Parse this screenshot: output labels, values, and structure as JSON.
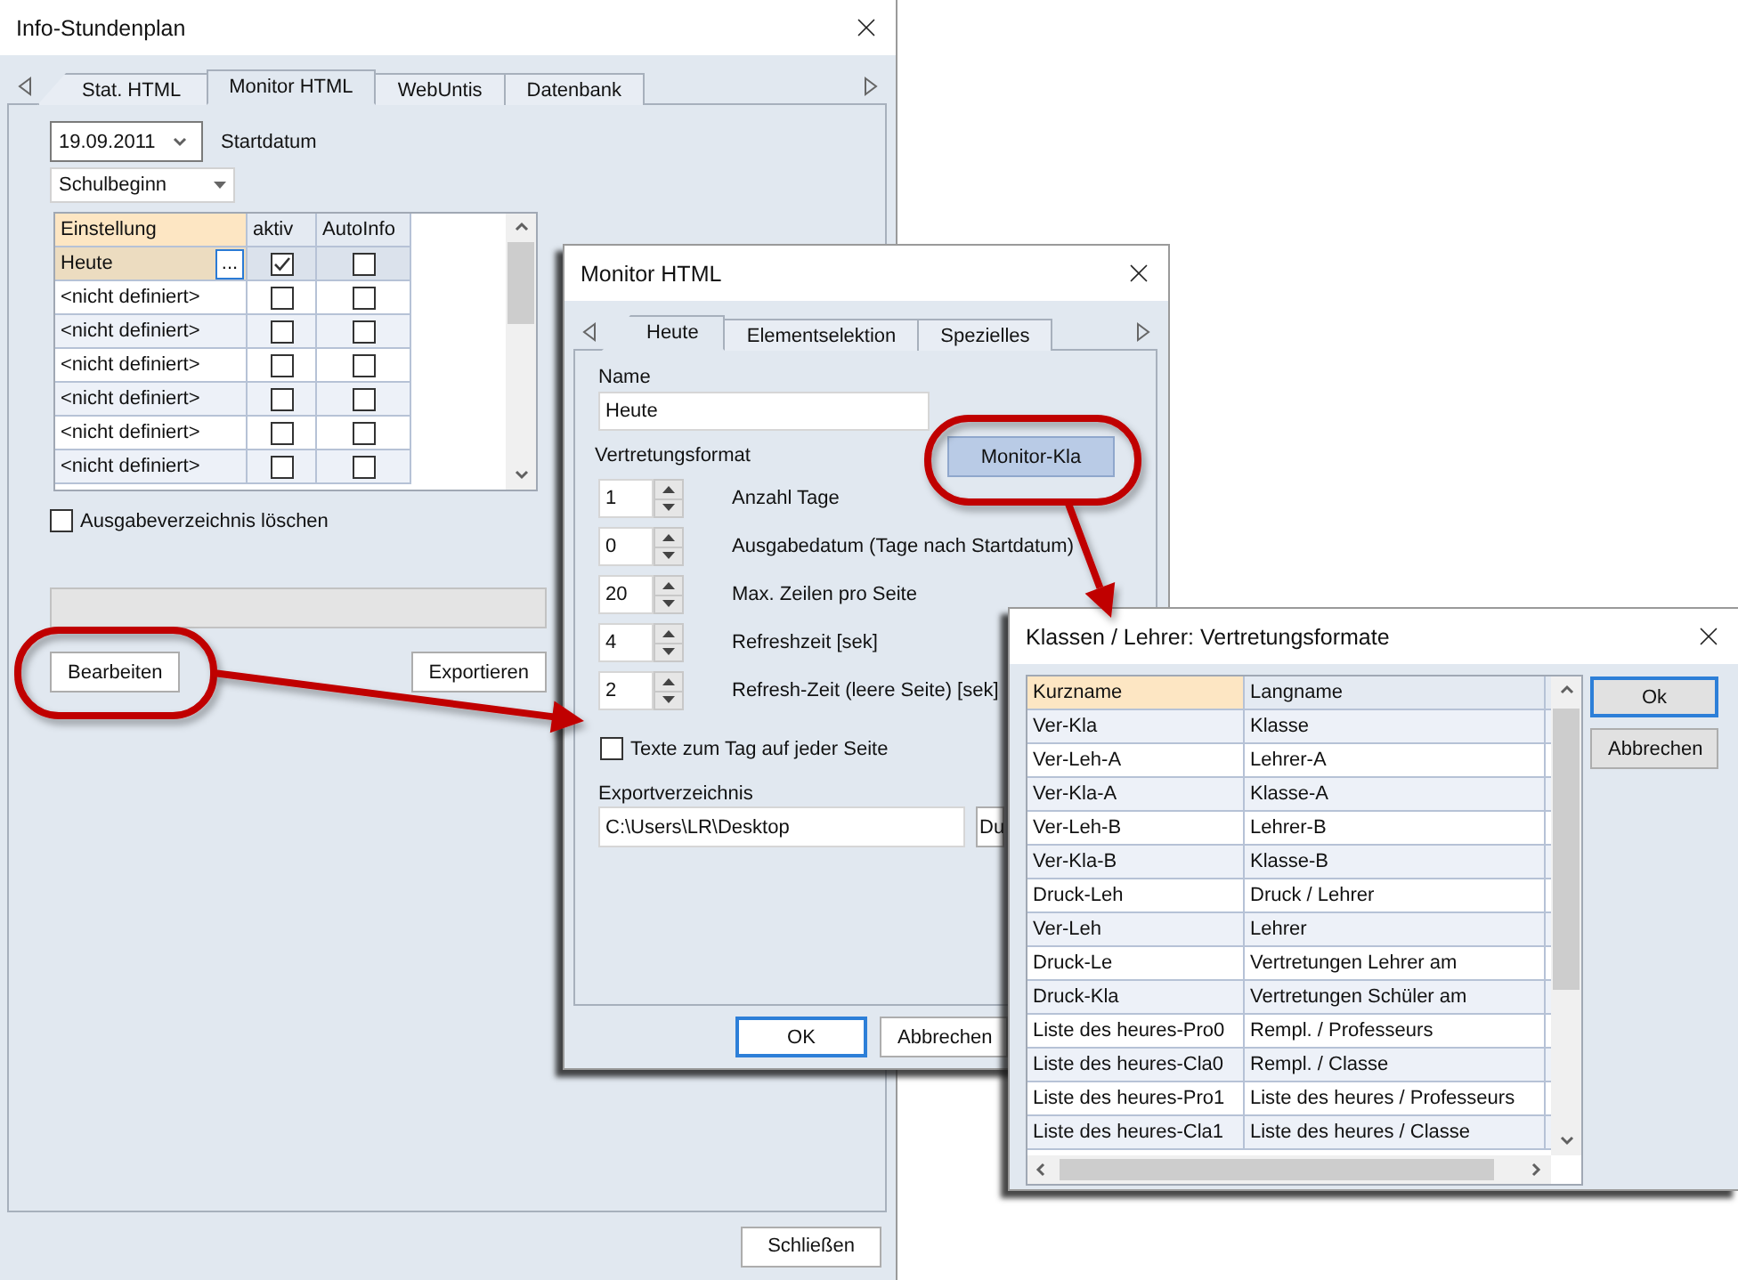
{
  "main_window": {
    "title": "Info-Stundenplan",
    "tabs": [
      {
        "label": "Stat. HTML",
        "selected": false
      },
      {
        "label": "Monitor HTML",
        "selected": true
      },
      {
        "label": "WebUntis",
        "selected": false
      },
      {
        "label": "Datenbank",
        "selected": false
      }
    ],
    "start_date": "19.09.2011",
    "start_date_label": "Startdatum",
    "start_mode": "Schulbeginn",
    "settings_table": {
      "columns": [
        {
          "label": "Einstellung",
          "highlighted": true
        },
        {
          "label": "aktiv",
          "highlighted": false
        },
        {
          "label": "AutoInfo",
          "highlighted": false
        }
      ],
      "cell_button": "...",
      "rows": [
        {
          "name": "Heute",
          "aktiv": true,
          "auto_info": false,
          "selected": true
        },
        {
          "name": "<nicht definiert>",
          "aktiv": false,
          "auto_info": false,
          "selected": false
        },
        {
          "name": "<nicht definiert>",
          "aktiv": false,
          "auto_info": false,
          "selected": false
        },
        {
          "name": "<nicht definiert>",
          "aktiv": false,
          "auto_info": false,
          "selected": false
        },
        {
          "name": "<nicht definiert>",
          "aktiv": false,
          "auto_info": false,
          "selected": false
        },
        {
          "name": "<nicht definiert>",
          "aktiv": false,
          "auto_info": false,
          "selected": false
        },
        {
          "name": "<nicht definiert>",
          "aktiv": false,
          "auto_info": false,
          "selected": false
        }
      ]
    },
    "clear_output_dir": {
      "label": "Ausgabeverzeichnis löschen",
      "checked": false
    },
    "edit_button": "Bearbeiten",
    "export_button": "Exportieren",
    "close_button": "Schließen"
  },
  "monitor_dialog": {
    "title": "Monitor HTML",
    "tabs": [
      {
        "label": "Heute",
        "selected": true
      },
      {
        "label": "Elementselektion",
        "selected": false
      },
      {
        "label": "Spezielles",
        "selected": false
      }
    ],
    "name_label": "Name",
    "name_value": "Heute",
    "format_label": "Vertretungsformat",
    "format_button": "Monitor-Kla",
    "spinners": [
      {
        "value": "1",
        "label": "Anzahl Tage"
      },
      {
        "value": "0",
        "label": "Ausgabedatum (Tage nach Startdatum)"
      },
      {
        "value": "20",
        "label": "Max. Zeilen pro Seite"
      },
      {
        "value": "4",
        "label": "Refreshzeit [sek]"
      },
      {
        "value": "2",
        "label": "Refresh-Zeit (leere Seite) [sek]"
      }
    ],
    "day_texts": {
      "label": "Texte zum Tag auf jeder Seite",
      "checked": false
    },
    "export_dir_label": "Exportverzeichnis",
    "export_dir": "C:\\Users\\LR\\Desktop",
    "browse_button": "Du",
    "buttons": [
      {
        "label": "OK",
        "default": true
      },
      {
        "label": "Abbrechen",
        "default": false
      }
    ]
  },
  "formats_dialog": {
    "title": "Klassen / Lehrer: Vertretungsformate",
    "columns": [
      {
        "label": "Kurzname",
        "highlighted": true
      },
      {
        "label": "Langname",
        "highlighted": false
      }
    ],
    "rows": [
      {
        "short": "Ver-Kla",
        "long": "Klasse"
      },
      {
        "short": "Ver-Leh-A",
        "long": "Lehrer-A"
      },
      {
        "short": "Ver-Kla-A",
        "long": "Klasse-A"
      },
      {
        "short": "Ver-Leh-B",
        "long": "Lehrer-B"
      },
      {
        "short": "Ver-Kla-B",
        "long": "Klasse-B"
      },
      {
        "short": "Druck-Leh",
        "long": "Druck / Lehrer"
      },
      {
        "short": "Ver-Leh",
        "long": "Lehrer"
      },
      {
        "short": "Druck-Le",
        "long": "Vertretungen Lehrer am"
      },
      {
        "short": "Druck-Kla",
        "long": "Vertretungen Schüler am"
      },
      {
        "short": "Liste des heures-Pro0",
        "long": "Rempl. / Professeurs"
      },
      {
        "short": "Liste des heures-Cla0",
        "long": "Rempl. / Classe"
      },
      {
        "short": "Liste des heures-Pro1",
        "long": "Liste des heures / Professeurs"
      },
      {
        "short": "Liste des heures-Cla1",
        "long": "Liste des heures / Classe"
      }
    ],
    "buttons": [
      {
        "label": "Ok",
        "default": true
      },
      {
        "label": "Abbrechen",
        "default": false
      }
    ]
  }
}
